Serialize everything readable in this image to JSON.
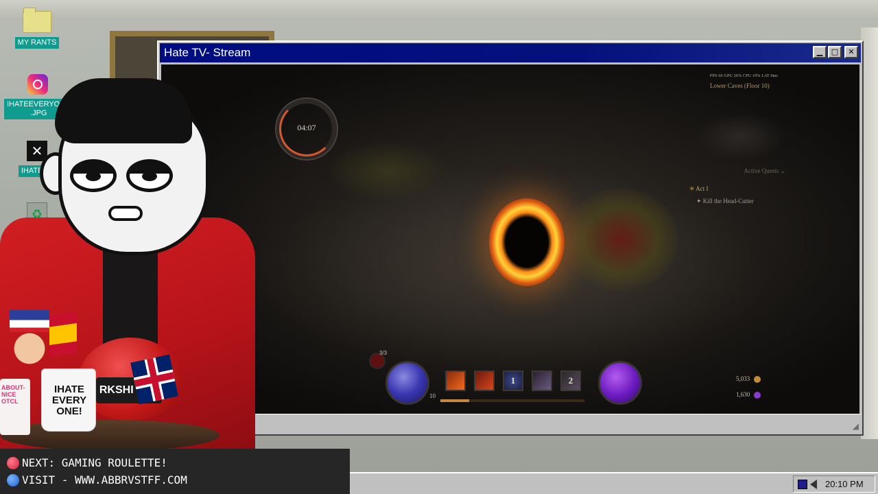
{
  "desktop": {
    "icons": [
      {
        "label": "MY RANTS",
        "icon": "folder-icon"
      },
      {
        "label": "IHATEEVERYONE\n.JPG",
        "icon": "instagram-icon"
      },
      {
        "label": "IHATEEV",
        "icon": "x-icon"
      },
      {
        "label": "",
        "icon": "recycle-bin-icon"
      }
    ]
  },
  "window": {
    "title": "Hate TV- Stream",
    "buttons": {
      "minimize": "▁",
      "maximize": "□",
      "close": "✕"
    }
  },
  "game": {
    "timer": "04:07",
    "perf": "FPS 60   GPU 26%   CPU 19%   LAT 0ms",
    "zone": "Lower Caves (Floor 10)",
    "quests_heading": "Active Quests",
    "act": "Act I",
    "task": "Kill the Head-Cutter",
    "potion": "3/3",
    "level": "10",
    "skill_slots": [
      "",
      "",
      "1",
      "",
      "2"
    ],
    "gold": "5,033",
    "shards": "1,630",
    "xp_fraction": 0.2
  },
  "overlay": {
    "tea_text": "RKSHI TEA",
    "mug_text": "IHATE EVERY ONE!",
    "mug_pink_text": "ABOUT- NICE OTCL"
  },
  "ticker": {
    "line1": "NEXT: GAMING ROULETTE!",
    "line2": "VISIT - WWW.ABBRVSTFF.COM"
  },
  "taskbar": {
    "clock": "20:10 PM"
  }
}
